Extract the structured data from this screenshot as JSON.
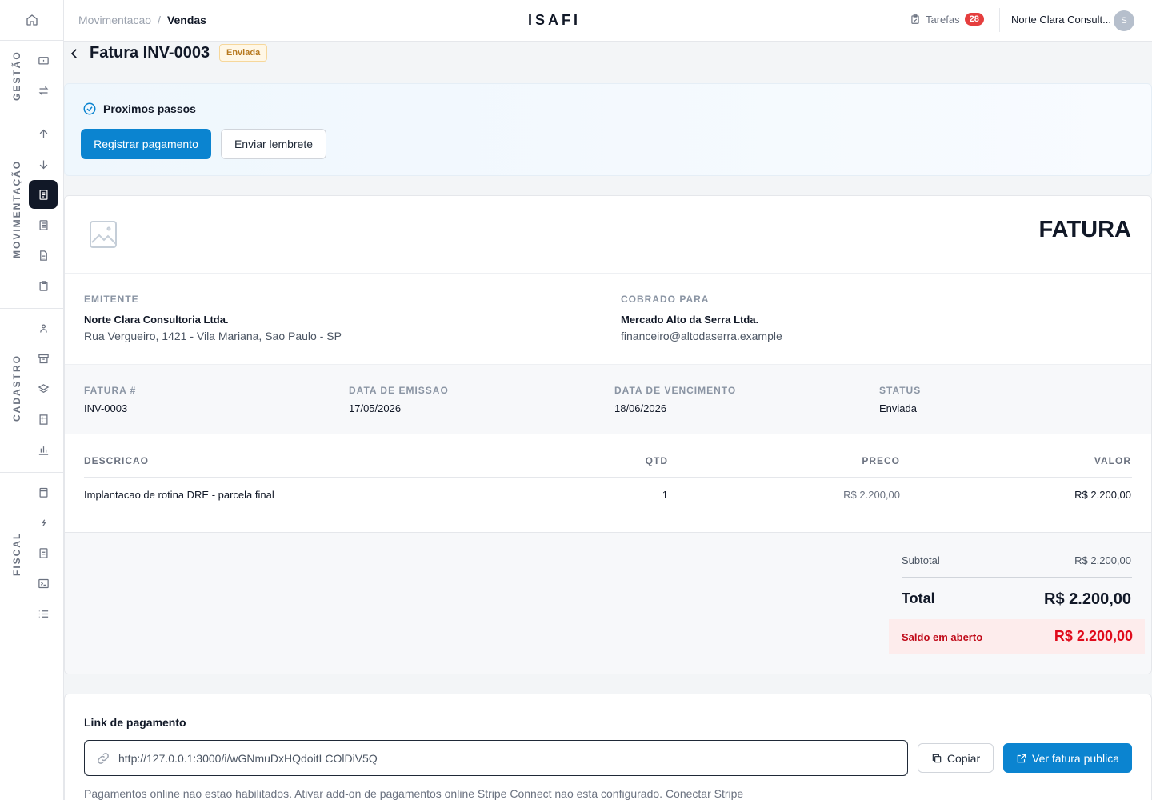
{
  "app": {
    "brand": "ISAFI"
  },
  "sidebar": {
    "groups": [
      {
        "label": "GESTÃO"
      },
      {
        "label": "MOVIMENTAÇÃO"
      },
      {
        "label": "CADASTRO"
      },
      {
        "label": "FISCAL"
      }
    ]
  },
  "header": {
    "breadcrumb": {
      "parent": "Movimentacao",
      "separator": "/",
      "current": "Vendas"
    },
    "tasks_label": "Tarefas",
    "tasks_count": "28",
    "company": "Norte Clara Consult...",
    "avatar_initial": "S"
  },
  "page": {
    "title": "Fatura INV-0003",
    "status_tag": "Enviada"
  },
  "next_steps": {
    "title": "Proximos passos",
    "primary_button": "Registrar pagamento",
    "secondary_button": "Enviar lembrete"
  },
  "invoice": {
    "heading": "FATURA",
    "issuer": {
      "label": "EMITENTE",
      "name": "Norte Clara Consultoria Ltda.",
      "address": "Rua Vergueiro, 1421 - Vila Mariana, Sao Paulo - SP"
    },
    "billed_to": {
      "label": "COBRADO PARA",
      "name": "Mercado Alto da Serra Ltda.",
      "email": "financeiro@altodaserra.example"
    },
    "meta": {
      "number_label": "FATURA #",
      "number": "INV-0003",
      "issue_label": "DATA DE EMISSAO",
      "issue_date": "17/05/2026",
      "due_label": "DATA DE VENCIMENTO",
      "due_date": "18/06/2026",
      "status_label": "STATUS",
      "status": "Enviada"
    },
    "table": {
      "headers": {
        "description": "DESCRICAO",
        "qty": "QTD",
        "price": "PRECO",
        "amount": "VALOR"
      },
      "rows": [
        {
          "description": "Implantacao de rotina DRE - parcela final",
          "qty": "1",
          "price": "R$ 2.200,00",
          "amount": "R$ 2.200,00"
        }
      ]
    },
    "totals": {
      "subtotal_label": "Subtotal",
      "subtotal": "R$ 2.200,00",
      "total_label": "Total",
      "total": "R$ 2.200,00",
      "balance_label": "Saldo em aberto",
      "balance": "R$ 2.200,00"
    }
  },
  "payment_link": {
    "title": "Link de pagamento",
    "url": "http://127.0.0.1:3000/i/wGNmuDxHQdoitLCOlDiV5Q",
    "copy_button": "Copiar",
    "view_button": "Ver fatura publica",
    "note": "Pagamentos online nao estao habilitados. Ativar add-on de pagamentos online Stripe Connect nao esta configurado. Conectar Stripe"
  },
  "colors": {
    "primary": "#0b84d0",
    "danger": "#e00b1c",
    "active_nav": "#111827",
    "badge": "#e53e3e"
  }
}
